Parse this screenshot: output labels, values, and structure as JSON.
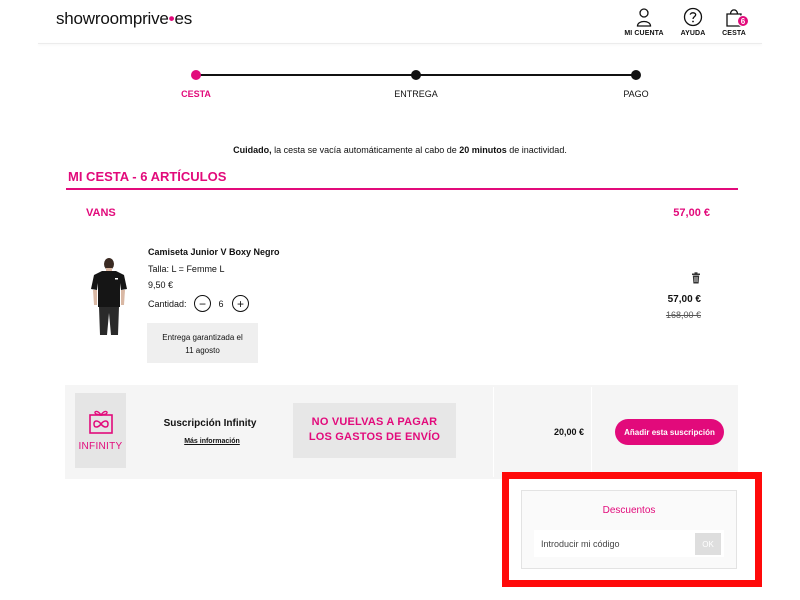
{
  "header": {
    "logo_main": "showroomprive",
    "logo_dot": "•",
    "logo_tld": "es",
    "account_label": "MI CUENTA",
    "help_label": "AYUDA",
    "cart_label": "CESTA",
    "cart_count": "6"
  },
  "steps": [
    {
      "label": "CESTA"
    },
    {
      "label": "ENTREGA"
    },
    {
      "label": "PAGO"
    }
  ],
  "notice": {
    "bold1": "Cuidado,",
    "text1": " la cesta se vacía automáticamente al cabo de ",
    "bold2": "20 minutos",
    "text2": " de inactividad."
  },
  "cart": {
    "title": "MI CESTA - 6 ARTÍCULOS",
    "brand": "VANS",
    "brand_total": "57,00 €",
    "item": {
      "name": "Camiseta Junior V Boxy Negro",
      "size": "Talla: L = Femme L",
      "unit_price": "9,50 €",
      "qty_label": "Cantidad:",
      "qty": "6",
      "delivery_line1": "Entrega garantizada el",
      "delivery_line2": "11 agosto",
      "total": "57,00 €",
      "old_total": "168,00 €"
    }
  },
  "infinity": {
    "logo_text": "INFINITY",
    "title": "Suscripción Infinity",
    "more_link": "Más información",
    "promo_line1": "NO VUELVAS A PAGAR",
    "promo_line2": "LOS GASTOS DE ENVÍO",
    "price": "20,00 €",
    "button": "Añadir esta suscripción"
  },
  "discount": {
    "title": "Descuentos",
    "placeholder": "Introducir mi código",
    "ok": "OK"
  },
  "colors": {
    "accent": "#e20a7b",
    "highlight": "#ff0a0a"
  }
}
